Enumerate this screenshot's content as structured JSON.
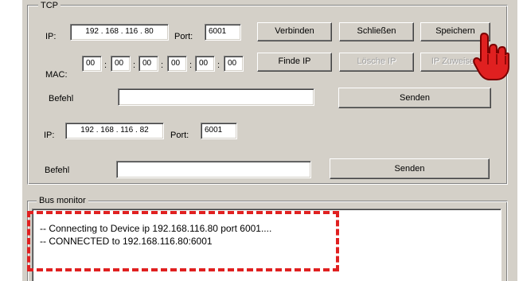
{
  "tcp_group": {
    "title": "TCP",
    "ip_label": "IP:",
    "ip_value": "192 . 168 . 116 . 80",
    "port_label": "Port:",
    "port_value": "6001",
    "mac_label": "MAC:",
    "mac_octets": [
      "00",
      "00",
      "00",
      "00",
      "00",
      "00"
    ],
    "befehl_label": "Befehl",
    "befehl_value": "",
    "buttons": {
      "connect": "Verbinden",
      "close": "Schließen",
      "save": "Speichern",
      "find_ip": "Finde IP",
      "delete_ip": "Lösche IP",
      "assign_ip": "IP Zuweisen",
      "send": "Senden"
    },
    "ip2_label": "IP:",
    "ip2_value": "192 . 168 . 116 . 82",
    "port2_label": "Port:",
    "port2_value": "6001",
    "befehl2_label": "Befehl",
    "befehl2_value": "",
    "send2": "Senden"
  },
  "bus_monitor": {
    "title": "Bus monitor",
    "lines": [
      "-- Connecting to Device ip 192.168.116.80 port 6001....",
      "-- CONNECTED to 192.168.116.80:6001"
    ]
  },
  "colors": {
    "window_bg": "#d4d0c8",
    "highlight": "#e02020",
    "cursor": "#e02020"
  },
  "cursor_icon": "hand-pointer-icon"
}
